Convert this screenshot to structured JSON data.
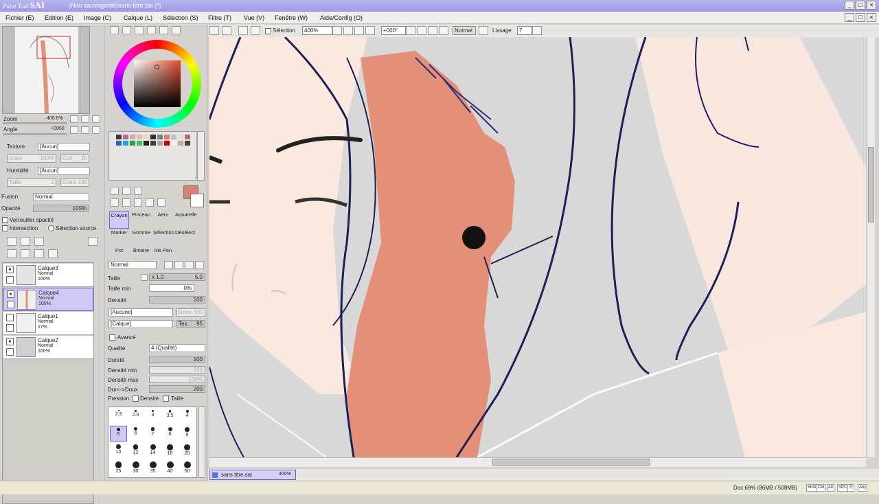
{
  "app": {
    "logo_small": "Paint Tool",
    "logo_big": "SAI",
    "title": "(Non sauvegardé)sans titre.sai (*)"
  },
  "window_buttons": [
    "_",
    "□",
    "×"
  ],
  "menu": [
    "Fichier (E)",
    "Edition (E)",
    "Image (C)",
    "Calque (L)",
    "Sélection (S)",
    "Filtre (T)",
    "Vue (V)",
    "Fenêtre (W)",
    "Aide/Config (O)"
  ],
  "toolbar": {
    "selection_label": "Sélection",
    "zoom": "400%",
    "angle": "+000°",
    "mode": "Normal",
    "lissage_label": "Lissage",
    "lissage_value": "7"
  },
  "navigator": {
    "zoom_label": "Zoom",
    "zoom_value": "400.0%",
    "angle_label": "Angle",
    "angle_value": "+0000"
  },
  "texture": {
    "texture_label": "Texture",
    "texture_value": "[Aucun]",
    "grain_label": "Grain",
    "grain_value": "100%",
    "cuir_label": "Cuir",
    "cuir_value": "20",
    "humidite_label": "Humidité",
    "humidite_value": "[Aucun]",
    "taille_label": "Taille",
    "taille_value": "1",
    "contr_label": "Contr",
    "contr_value": "100"
  },
  "layer_props": {
    "fusion_label": "Fusion",
    "fusion_value": "Normal",
    "opacite_label": "Opacité",
    "opacite_value": "100%",
    "verrouiller": "Verrouiller opacité",
    "intersection": "Intersection",
    "selection_source": "Sélection source"
  },
  "layers": [
    {
      "name": "Calque3",
      "mode": "Normal",
      "opacity": "100%",
      "selected": false
    },
    {
      "name": "Calque4",
      "mode": "Normal",
      "opacity": "100%",
      "selected": true
    },
    {
      "name": "Calque1",
      "mode": "Normal",
      "opacity": "27%",
      "selected": false
    },
    {
      "name": "Calque2",
      "mode": "Normal",
      "opacity": "100%",
      "selected": false
    }
  ],
  "colors": {
    "current": "#d9826e",
    "accent": "#6b63d8",
    "selection_bg": "#cfc9f5",
    "skin": "#fbe9df",
    "hair": "#e48f77",
    "line": "#1e1f55"
  },
  "palette": [
    "#3a3a3a",
    "#b86c9a",
    "#e6a0a8",
    "#e0c0b0",
    "#f0d8c8",
    "#2c2c2c",
    "#808080",
    "#d9826e",
    "#c0c0c0",
    "#e8e0d8",
    "#b07070",
    "#3060c0",
    "#30a0d0",
    "#20a040",
    "#40c060",
    "#202020",
    "#404040",
    "#a8a8a8",
    "#c80000",
    "#f0f0f0",
    "#d4a48c",
    "#404040"
  ],
  "tools": [
    {
      "name": "Crayon",
      "selected": true
    },
    {
      "name": "Pinceau",
      "selected": false
    },
    {
      "name": "Aéro",
      "selected": false
    },
    {
      "name": "Aquarelle",
      "selected": false
    },
    {
      "name": "Marker",
      "selected": false
    },
    {
      "name": "Gomme",
      "selected": false
    },
    {
      "name": "Sélection",
      "selected": false
    },
    {
      "name": "Désélect",
      "selected": false
    },
    {
      "name": "Pot",
      "selected": false
    },
    {
      "name": "Binaire",
      "selected": false
    },
    {
      "name": "Ink Pen",
      "selected": false
    },
    {
      "name": "",
      "selected": false
    }
  ],
  "brush": {
    "mode": "Normal",
    "taille_label": "Taille",
    "taille_mult": "x 1.0",
    "taille_value": "5.0",
    "taille_min_label": "Taille min",
    "taille_min_value": "0%",
    "densite_label": "Densité",
    "densite_value": "100",
    "shape1": "[Aucune]",
    "dens_label": "Dens",
    "dens_value": "100",
    "shape2": "[Calque]",
    "tex_label": "Tex.",
    "tex_value": "95",
    "avance_label": "Avancé",
    "qualite_label": "Qualité",
    "qualite_value": "4 (Qualité)",
    "durete_label": "Dureté",
    "durete_value": "100",
    "densite_min_label": "Densité min",
    "densite_min_value": "100",
    "densite_max_label": "Densité max",
    "densite_max_value": "100%",
    "durdoux_label": "Dur<->Doux",
    "durdoux_value": "200",
    "pression_label": "Pression",
    "pression_densite": "Densité",
    "pression_taille": "Taille"
  },
  "brush_sizes": [
    "2.3",
    "2.6",
    "3",
    "3.5",
    "4",
    "5",
    "6",
    "7",
    "8",
    "9",
    "10",
    "12",
    "14",
    "16",
    "20",
    "25",
    "30",
    "35",
    "40",
    "50"
  ],
  "tab": {
    "name": "sans titre.sai",
    "zoom": "400%"
  },
  "status": {
    "doc": "Doc:69% (86MB / 508MB)",
    "keys": [
      "Shift",
      "Ctrl",
      "Alt",
      "SPC",
      "Ⓐ",
      "Any"
    ]
  }
}
